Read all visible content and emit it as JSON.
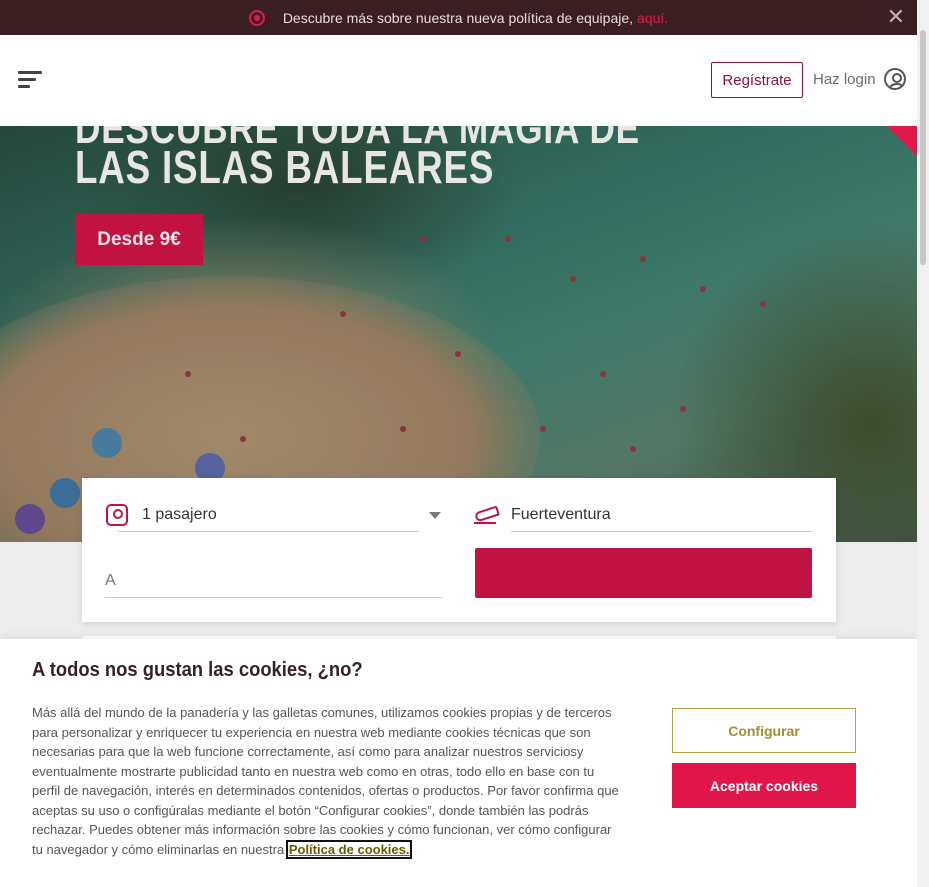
{
  "topbar": {
    "message": "Descubre más sobre nuestra nueva política de equipaje,",
    "link": "aquí.",
    "close_icon": "close-icon"
  },
  "header": {
    "menu_icon": "menu-icon",
    "register_label": "Regístrate",
    "login_label": "Haz login",
    "user_icon": "user-icon"
  },
  "hero": {
    "headline_top": "DESCUBRE TODA LA MAGIA DE",
    "headline": "LAS ISLAS BALEARES",
    "price_button": "Desde 9€"
  },
  "search": {
    "passengers": "1 pasajero",
    "origin": "Fuerteventura",
    "destination_placeholder": "A"
  },
  "cookies": {
    "title": "A todos nos gustan las cookies, ¿no?",
    "body": "Más allá del mundo de la panadería y las galletas comunes, utilizamos cookies propias y de terceros para personalizar y enriquecer tu experiencia en nuestra web mediante cookies técnicas que son necesarias para que la web funcione correctamente, así como para analizar nuestros serviciosy eventualmente mostrarte publicidad tanto en nuestra web como en otras, todo ello en base con tu perfil de navegación, interés en determinados contenidos, ofertas o productos. Por favor confirma que aceptas su uso o configúralas mediante el botón “Configurar cookies”, donde también las podrás rechazar. Puedes obtener más información sobre las cookies y cómo funcionan, ver cómo configurar tu navegador y cómo eliminarlas en nuestra",
    "policy_link": "Política de cookies.",
    "configure_button": "Configurar",
    "accept_button": "Aceptar cookies"
  },
  "colors": {
    "brand": "#c01341",
    "accent": "#e0194b",
    "topbar_bg": "#3a1f22",
    "configure_border": "#b8a24a"
  }
}
